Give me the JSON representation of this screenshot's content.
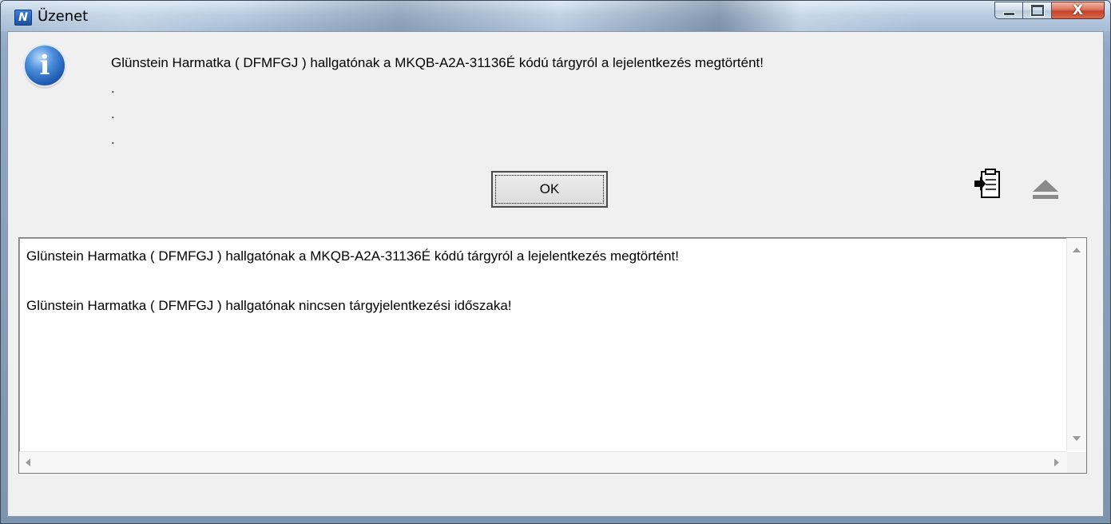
{
  "window": {
    "title": "Üzenet",
    "app_icon_glyph": "N",
    "close_glyph": "X"
  },
  "message": {
    "icon": "info-icon",
    "icon_glyph": "i",
    "lines": [
      "Glünstein Harmatka ( DFMFGJ ) hallgatónak a MKQB-A2A-31136É kódú tárgyról a lejelentkezés megtörtént!",
      ".",
      ".",
      "."
    ]
  },
  "buttons": {
    "ok_label": "OK"
  },
  "tools": {
    "copy_icon": "clipboard-copy-icon",
    "toggle_icon": "eject-icon"
  },
  "log": {
    "lines": [
      "Glünstein Harmatka ( DFMFGJ ) hallgatónak a MKQB-A2A-31136É kódú tárgyról a lejelentkezés megtörtént!",
      "Glünstein Harmatka ( DFMFGJ ) hallgatónak nincsen tárgyjelentkezési időszaka!"
    ]
  }
}
